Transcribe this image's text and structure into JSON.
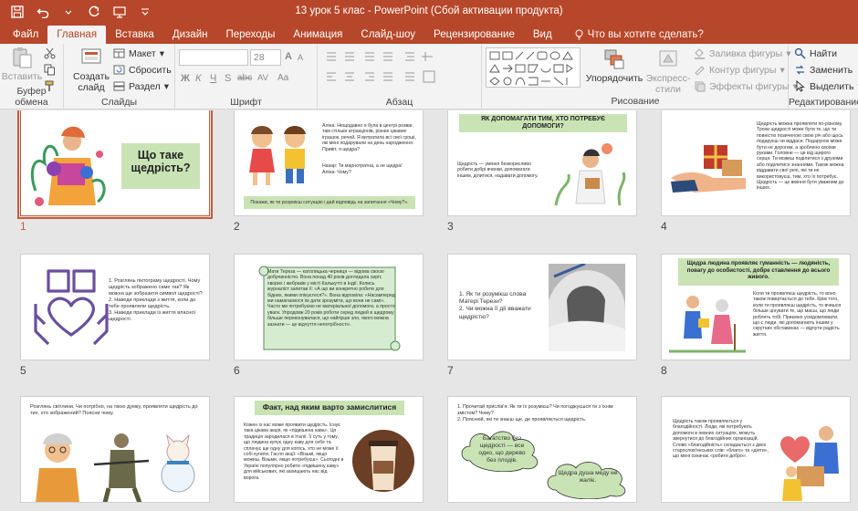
{
  "window": {
    "title": "13 урок 5 клас - PowerPoint (Сбой активации продукта)"
  },
  "tabs": [
    {
      "label": "Файл",
      "active": false
    },
    {
      "label": "Главная",
      "active": true
    },
    {
      "label": "Вставка",
      "active": false
    },
    {
      "label": "Дизайн",
      "active": false
    },
    {
      "label": "Переходы",
      "active": false
    },
    {
      "label": "Анимация",
      "active": false
    },
    {
      "label": "Слайд-шоу",
      "active": false
    },
    {
      "label": "Рецензирование",
      "active": false
    },
    {
      "label": "Вид",
      "active": false
    }
  ],
  "tell_me": "Что вы хотите сделать?",
  "ribbon": {
    "clipboard": {
      "label": "Буфер обмена",
      "paste": "Вставить"
    },
    "slides": {
      "label": "Слайды",
      "new_slide_line1": "Создать",
      "new_slide_line2": "слайд",
      "layout": "Макет",
      "reset": "Сбросить",
      "section": "Раздел"
    },
    "font": {
      "label": "Шрифт",
      "size": "28",
      "bold": "Ж",
      "italic": "К",
      "underline": "Ч",
      "strike": "S",
      "abc": "abc",
      "av": "AV",
      "aa": "Aa",
      "a_big": "A",
      "a_small": "A"
    },
    "paragraph": {
      "label": "Абзац"
    },
    "drawing": {
      "label": "Рисование",
      "arrange": "Упорядочить",
      "quick_styles_line1": "Экспресс-",
      "quick_styles_line2": "стили",
      "fill": "Заливка фигуры",
      "outline": "Контур фигуры",
      "effects": "Эффекты фигуры"
    },
    "editing": {
      "label": "Редактирование",
      "find": "Найти",
      "replace": "Заменить",
      "select": "Выделить"
    }
  },
  "slides": [
    {
      "num": "1",
      "selected": true,
      "title": "Що таке щедрість?"
    },
    {
      "num": "2",
      "selected": false,
      "dialog": [
        "Аліна: Нещодавно я була в центрі розваг, там стільки атракціонів, різних цікавих іграшок, речей. Я витратила всі свої гроші, які мені подарували на день народження. Привіт, я щедра?",
        "Назар: Ти марнотратна, а не щедра!",
        "Аліна: Чому?"
      ],
      "footer": "Покажи, як ти розумієш ситуацію і дай відповідь на запитання «Чому?»."
    },
    {
      "num": "3",
      "selected": false,
      "title": "ЯК ДОПОМАГАТИ ТИМ, ХТО ПОТРЕБУЄ ДОПОМОГИ?",
      "text": "Щедрість — уміння безкорисливо робити добрі вчинки, допомагати іншим, ділитися, надавати допомогу."
    },
    {
      "num": "4",
      "selected": false,
      "text": "Щедрість можна проявляти по-різному. Трохи щедрості може бути те, що ти повністю позиченою свою річ або щось подаруєш чи віддаси. Подарунок може бути не дорогим, а зроблено своїми руками. Головне — це від щирого серця. Ти можеш поділитися з друзями або поділитися знаннями. Також можна віддавати свої речі, які ти не використовуєш, тим, хто їх потребує. Щедрість — це вміння бути уважним до інших."
    },
    {
      "num": "5",
      "selected": false,
      "text": "1. Розглянь піктограму щедрості. Чому щедрість зображено саме так? Як можна ще зобразити символ щедрості?\n2. Наведи приклади з життя, коли до тебе проявляли щедрість.\n3. Наведи приклади із життя власної щедрості."
    },
    {
      "num": "6",
      "selected": false,
      "text": "Мати Тереза — католицька черниця — відома своєю добрчинністю. Вона понад 40 років доглядала сиріт, хворих і жебраків у місті Калькутті в Індії. Колись журналіст запитав її: «А що ви конкретно робите для бідних, якими опікуєтеся?». Вона відповіла: «Насамперед ми намагаємося їм дати зрозуміти, що вони не самі». Часто ми потребуємо не матеріальної допомоги, а просто уваги. Упродовж 20 років роботи серед людей в щедрому більше переконувалася, що найгірше зло, якого можна зазнати — це відчуття непотрібності»."
    },
    {
      "num": "7",
      "selected": false,
      "text": "1. Як ти розумієш слова Матері Терези?\n2. Чи можна її дії вважати щедрістю?"
    },
    {
      "num": "8",
      "selected": false,
      "title": "Щедра людина проявляє гуманність — людяність, повагу до особистості, добре ставлення до всього живого.",
      "text": "Коли ти проявляєш щедрість, то воно також повертається до тебе. Крім того, коли ти проявляєш щедрість, то вчишся більше цінувати те, що маєш, що люди роблять тобі. Приємно усвідомлювати, що є люди, які допомагають іншим у скрутних обставинах — відчути радість життя."
    },
    {
      "num": "9",
      "selected": false,
      "text": "Розглянь світлини. Чи потрібно, на твою думку, проявляти щедрість до тих, хто зображений? Поясни чому."
    },
    {
      "num": "10",
      "selected": false,
      "title": "Факт, над яким варто замислитися",
      "text": "Кожен із нас може проявити щедрість. Існує така цікава акція, як «підвішена кава». Ця традиція зародилася в Італії. Її суть у тому, що людина купує одну каву для себе та сплачує ще одну для когось, хто не може її собі купити. Гасло акції: «Візьмі, якщо можеш. Візьми, якщо потребуєш». Сьогодні в Україні популярно робити «підвішену каву» для військових, які захищають нас від ворога."
    },
    {
      "num": "11",
      "selected": false,
      "text": "1. Прочитай прислів'я. Як ти їх розумієш? Чи погоджуєшся ти з їхнім змістом? Чому?\n2. Пояснюй, які ти знаєш ще, де проявляється щедрість.",
      "cloud1": "Багатство без щедрості — все одно, що дерево без плодів.",
      "cloud2": "Щедра душа меду не жаліє."
    },
    {
      "num": "12",
      "selected": false,
      "text": "Щедрість також проявляється у благодійності. Люди, які потребують допомоги в певних ситуаціях, можуть звернутися до благодійних організацій. Слово «благодійність» складається з двох старослов'янських слів: «благо» та «діяти», що мені означає «робити добро»."
    }
  ],
  "colors": {
    "accent": "#b7472a",
    "selection": "#c55a3a",
    "slide_green": "#c9e3b5",
    "purple": "#6b4f9f"
  }
}
